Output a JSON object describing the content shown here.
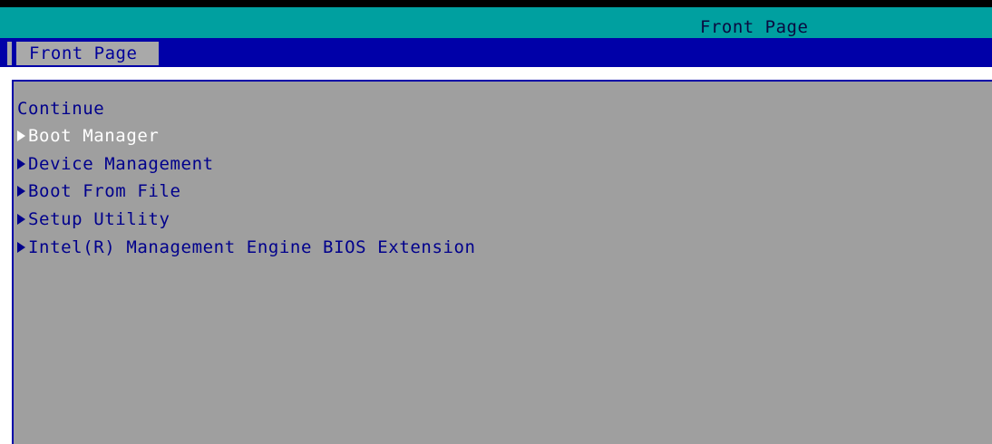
{
  "header": {
    "title": "Front Page"
  },
  "tabs": [
    {
      "label": "Front Page",
      "active": true
    }
  ],
  "menu": {
    "items": [
      {
        "label": "Continue",
        "submenu": false,
        "selected": false
      },
      {
        "label": "Boot Manager",
        "submenu": true,
        "selected": true
      },
      {
        "label": "Device Management",
        "submenu": true,
        "selected": false
      },
      {
        "label": "Boot From File",
        "submenu": true,
        "selected": false
      },
      {
        "label": "Setup Utility",
        "submenu": true,
        "selected": false
      },
      {
        "label": "Intel(R) Management Engine BIOS Extension",
        "submenu": true,
        "selected": false
      }
    ]
  },
  "colors": {
    "title_bar": "#00a0a0",
    "tab_bar": "#0000a8",
    "content_bg": "#9f9f9f",
    "item_text": "#00008c",
    "selected_text": "#ffffff"
  },
  "icons": {
    "submenu": "triangle-right-icon"
  }
}
